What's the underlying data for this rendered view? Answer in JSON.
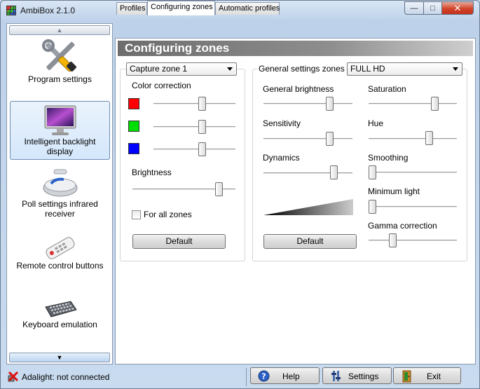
{
  "window": {
    "title": "AmbiBox 2.1.0",
    "close_glyph": "✕",
    "max_glyph": "□",
    "min_glyph": "—"
  },
  "sidebar": {
    "items": [
      {
        "label": "Program settings",
        "icon": "tools-icon"
      },
      {
        "label": "Intelligent backlight display",
        "icon": "monitor-icon",
        "selected": true
      },
      {
        "label": "Poll settings infrared receiver",
        "icon": "ir-receiver-icon"
      },
      {
        "label": "Remote control buttons",
        "icon": "remote-control-icon"
      },
      {
        "label": "Keyboard emulation",
        "icon": "keyboard-icon"
      }
    ],
    "scroll_up_glyph": "▲",
    "scroll_down_glyph": "▼"
  },
  "tabs": [
    {
      "label": "Profiles"
    },
    {
      "label": "Configuring zones",
      "active": true
    },
    {
      "label": "Automatic profiles"
    }
  ],
  "panel": {
    "header": "Configuring zones",
    "left": {
      "zone_select": "Capture zone 1",
      "color_correction_label": "Color correction",
      "red_level": 0.6,
      "green_level": 0.6,
      "blue_level": 0.6,
      "brightness_label": "Brightness",
      "brightness_level": 0.87,
      "for_all_zones_label": "For all zones",
      "for_all_zones_checked": false,
      "default_button": "Default",
      "colors": {
        "red": "#ff0000",
        "green": "#00dd00",
        "blue": "#0000ff"
      }
    },
    "right": {
      "group_label": "General settings zones",
      "preset_select": "FULL HD",
      "general_brightness_label": "General brightness",
      "general_brightness_level": 0.77,
      "sensitivity_label": "Sensitivity",
      "sensitivity_level": 0.77,
      "dynamics_label": "Dynamics",
      "dynamics_level": 0.82,
      "saturation_label": "Saturation",
      "saturation_level": 0.77,
      "hue_label": "Hue",
      "hue_level": 0.7,
      "smoothing_label": "Smoothing",
      "smoothing_level": 0.0,
      "minimum_light_label": "Minimum light",
      "minimum_light_level": 0.0,
      "gamma_correction_label": "Gamma correction",
      "gamma_correction_level": 0.25,
      "default_button": "Default"
    }
  },
  "status": {
    "connection_text": "Adalight: not connected",
    "help_button": "Help",
    "settings_button": "Settings",
    "exit_button": "Exit"
  }
}
